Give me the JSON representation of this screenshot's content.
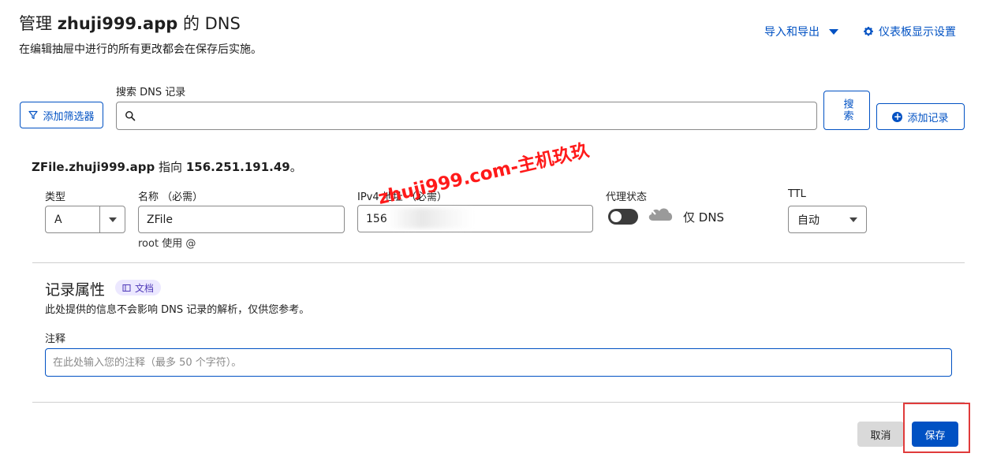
{
  "header": {
    "title_prefix": "管理",
    "title_domain": "zhuji999.app",
    "title_suffix": "的 DNS",
    "subtitle": "在编辑抽屉中进行的所有更改都会在保存后实施。",
    "import_export_label": "导入和导出",
    "dashboard_settings_label": "仪表板显示设置"
  },
  "search": {
    "filter_label": "添加筛选器",
    "label": "搜索 DNS 记录",
    "placeholder": "",
    "button_label": "搜索",
    "add_record_label": "添加记录"
  },
  "record": {
    "name_bold": "ZFile.zhuji999.app",
    "points_to": "指向",
    "ip_bold": "156.251.191.49",
    "end_punct": "。",
    "type_label": "类型",
    "type_value": "A",
    "name_label": "名称 （必需）",
    "name_value": "ZFile",
    "name_hint": "root 使用 @",
    "ip_label": "IPv4 地址 （必需）",
    "ip_value": "156",
    "proxy_label": "代理状态",
    "proxy_status": "仅 DNS",
    "proxy_enabled": false,
    "ttl_label": "TTL",
    "ttl_value": "自动"
  },
  "attributes": {
    "title": "记录属性",
    "doc_badge": "文档",
    "description": "此处提供的信息不会影响 DNS 记录的解析，仅供您参考。",
    "comment_label": "注释",
    "comment_placeholder": "在此处输入您的注释（最多 50 个字符）。"
  },
  "footer": {
    "cancel_label": "取消",
    "save_label": "保存"
  },
  "watermark": "zhuji999.com-主机玖玖",
  "colors": {
    "accent": "#0051c3",
    "highlight": "#e03b3b",
    "watermark": "#ff1a1a",
    "badge_bg": "#ece8ff"
  }
}
